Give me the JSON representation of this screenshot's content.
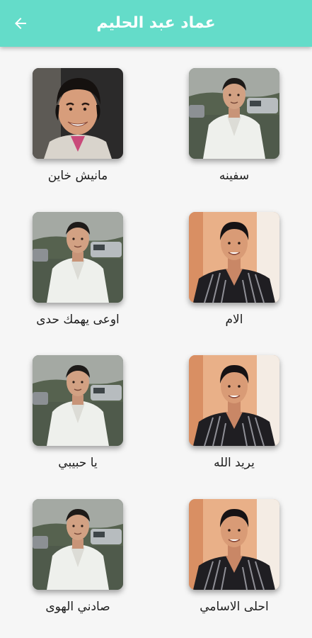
{
  "header": {
    "title": "عماد عبد الحليم",
    "back_icon": "arrow-left-icon",
    "background": "#64dcc9"
  },
  "songs": [
    {
      "title": "سفينه",
      "photo": "outdoor-jacket"
    },
    {
      "title": "مانيش خاين",
      "photo": "portrait-smiling"
    },
    {
      "title": "الام",
      "photo": "studio-striped-shirt"
    },
    {
      "title": "اوعى يهمك حدى",
      "photo": "outdoor-jacket"
    },
    {
      "title": "يريد الله",
      "photo": "studio-striped-shirt"
    },
    {
      "title": "يا حبيبي",
      "photo": "outdoor-jacket"
    },
    {
      "title": "احلى الاسامي",
      "photo": "studio-striped-shirt"
    },
    {
      "title": "صادني الهوى",
      "photo": "outdoor-jacket"
    }
  ]
}
